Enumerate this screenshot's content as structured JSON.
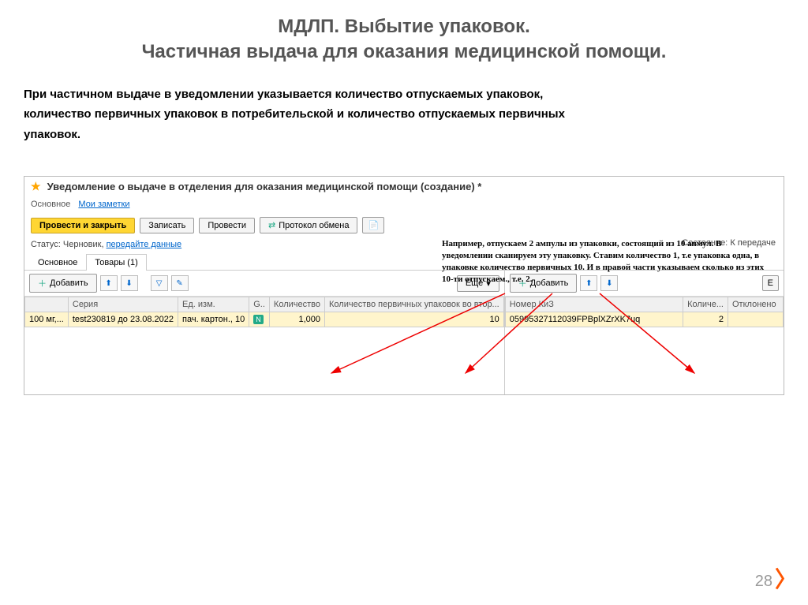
{
  "slide": {
    "title_line1": "МДЛП. Выбытие упаковок.",
    "title_line2": "Частичная выдача для оказания медицинской помощи.",
    "description": "При частичном выдаче в уведомлении указывается количество отпускаемых упаковок, количество первичных упаковок в потребительской и количество отпускаемых первичных упаковок.",
    "page_number": "28"
  },
  "window": {
    "title": "Уведомление о выдаче в отделения для оказания медицинской помощи (создание) *",
    "nav1_main": "Основное",
    "nav1_notes": "Мои заметки",
    "btn_post_close": "Провести и закрыть",
    "btn_save": "Записать",
    "btn_post": "Провести",
    "btn_protocol": "Протокол обмена",
    "status_label": "Статус:",
    "status_value": "Черновик,",
    "status_link": "передайте данные",
    "state_label": "Состояние:",
    "state_value": "К передаче",
    "tab_main": "Основное",
    "tab_goods": "Товары (1)",
    "btn_add": "Добавить",
    "btn_more": "Еще",
    "btn_e": "Е"
  },
  "left_table": {
    "col1": "",
    "col2": "Серия",
    "col3": "Ед. изм.",
    "col4": "G..",
    "col5": "Количество",
    "col6": "Количество первичных упаковок во втор...",
    "row": {
      "c1": "100 мг,...",
      "c2": "test230819 до 23.08.2022",
      "c3": "пач. картон., 10",
      "c4": "N",
      "c5": "1,000",
      "c6": "10"
    }
  },
  "right_table": {
    "col1": "Номер КиЗ",
    "col2": "Количе...",
    "col3": "Отклонено",
    "row": {
      "c1": "05995327112039FPBplXZrXK7uq",
      "c2": "2",
      "c3": ""
    }
  },
  "annotation": {
    "text": "Например, отпускаем 2 ампулы из упаковки, состоящий из 10 апмул. В уведомлении сканируем эту упаковку. Ставим количество 1, т.е упаковка одна, в упаковке количество первичных 10. И в правой части указываем сколько из этих 10-ти отпускаем., т.е. 2."
  }
}
